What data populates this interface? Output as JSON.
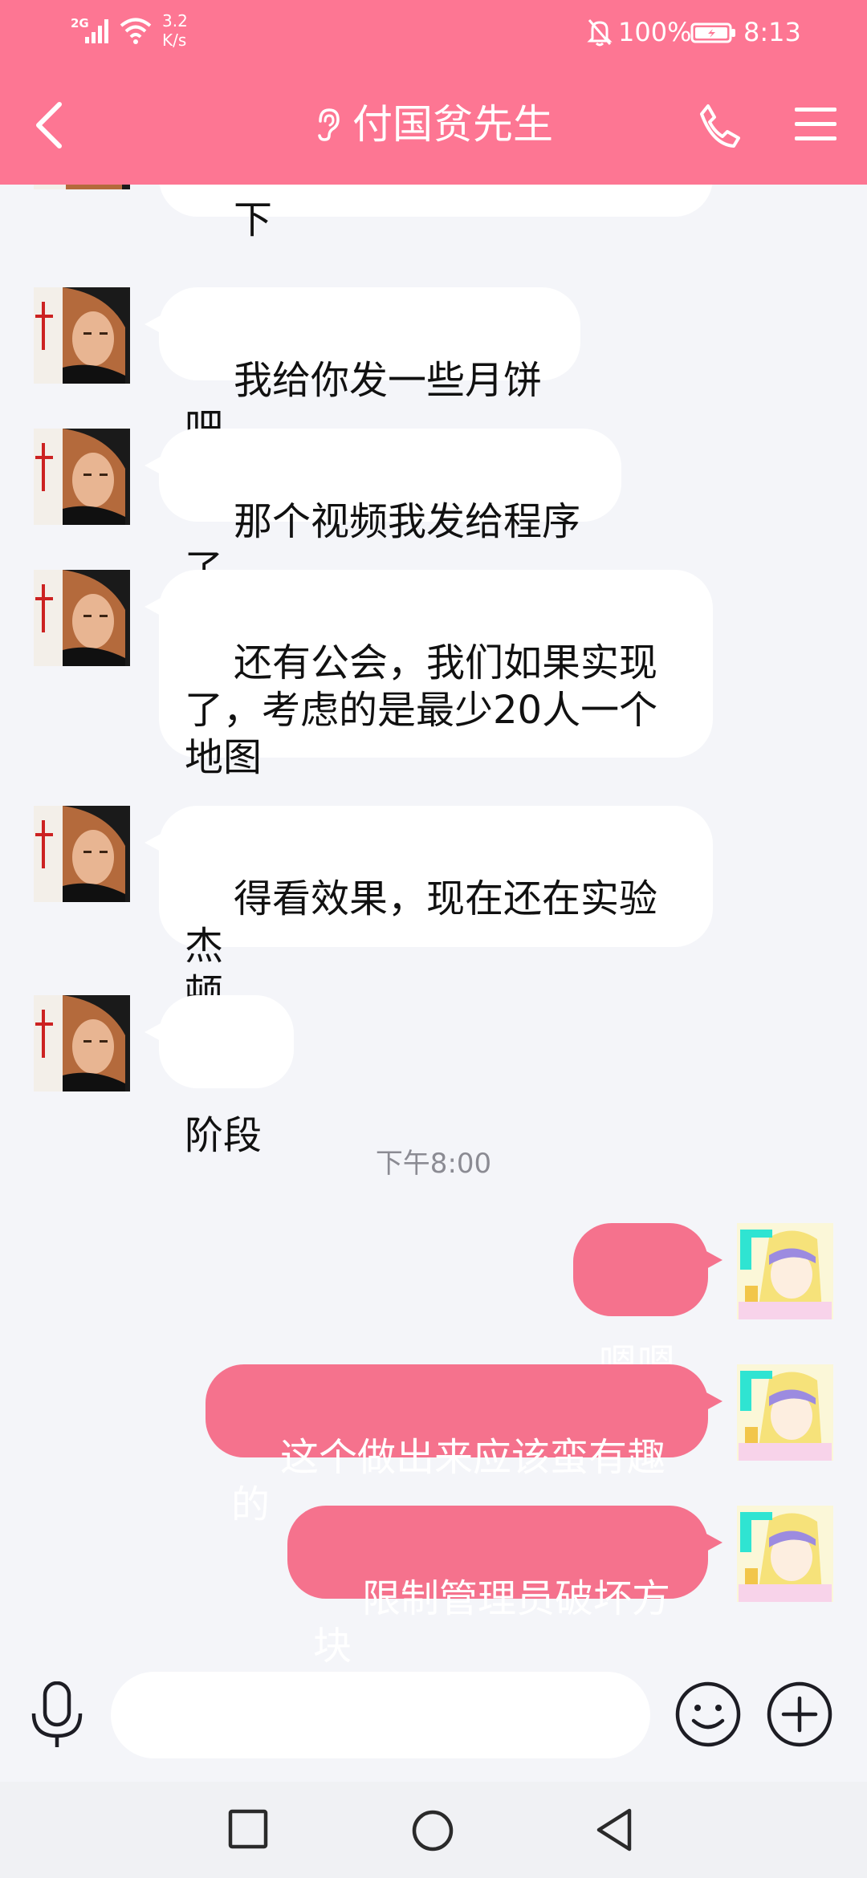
{
  "status_bar": {
    "network": "2G",
    "net_speed": "3.2\nK/s",
    "battery": "100%",
    "time": "8:13"
  },
  "header": {
    "title": "付国贫先生"
  },
  "messages": [
    {
      "side": "in",
      "text": "下"
    },
    {
      "side": "in",
      "text": "我给你发一些月饼吧"
    },
    {
      "side": "in",
      "text": "那个视频我发给程序了"
    },
    {
      "side": "in",
      "text": "还有公会，我们如果实现\n了，考虑的是最少20人一个\n地图"
    },
    {
      "side": "in",
      "text": "得看效果，现在还在实验杰\n顿"
    },
    {
      "side": "in",
      "text": "阶段"
    },
    {
      "timestamp": "下午8:00"
    },
    {
      "side": "out",
      "text": "嗯嗯"
    },
    {
      "side": "out",
      "text": "这个做出来应该蛮有趣的"
    },
    {
      "side": "out",
      "text": "限制管理员破坏方块"
    }
  ],
  "input": {
    "placeholder": ""
  },
  "colors": {
    "header": "#fd7693",
    "outgoing_bubble": "#f5728d",
    "incoming_bubble": "#ffffff",
    "background": "#f4f5f9"
  },
  "icons": [
    "back-icon",
    "ear-icon",
    "phone-icon",
    "menu-icon",
    "microphone-icon",
    "emoji-icon",
    "plus-icon",
    "nav-recent-icon",
    "nav-home-icon",
    "nav-back-icon"
  ]
}
